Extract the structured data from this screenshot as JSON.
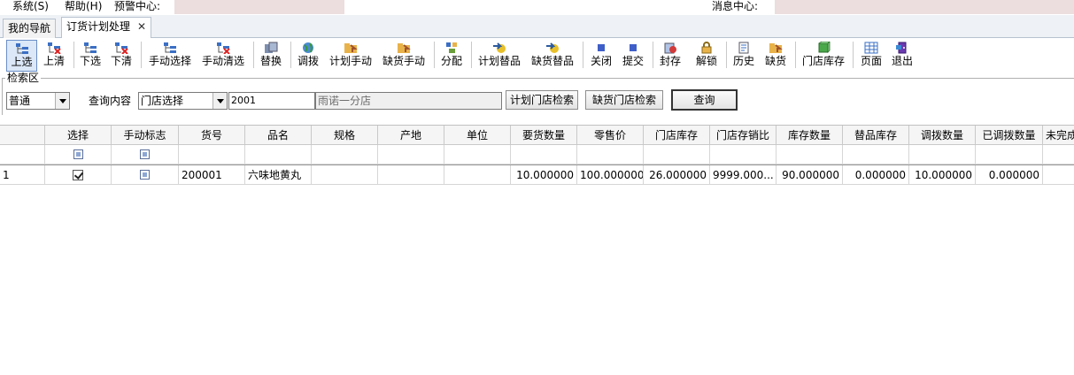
{
  "menubar": {
    "system": "系统(S)",
    "help": "帮助(H)",
    "alert_center": "预警中心:",
    "message_center": "消息中心:"
  },
  "tabs": [
    {
      "label": "我的导航"
    },
    {
      "label": "订货计划处理"
    }
  ],
  "toolbar": [
    {
      "label": "上选"
    },
    {
      "label": "上清"
    },
    {
      "label": "下选"
    },
    {
      "label": "下清"
    },
    {
      "label": "手动选择"
    },
    {
      "label": "手动清选"
    },
    {
      "label": "替换"
    },
    {
      "label": "调拨"
    },
    {
      "label": "计划手动"
    },
    {
      "label": "缺货手动"
    },
    {
      "label": "分配"
    },
    {
      "label": "计划替品"
    },
    {
      "label": "缺货替品"
    },
    {
      "label": "关闭"
    },
    {
      "label": "提交"
    },
    {
      "label": "封存"
    },
    {
      "label": "解锁"
    },
    {
      "label": "历史"
    },
    {
      "label": "缺货"
    },
    {
      "label": "门店库存"
    },
    {
      "label": "页面"
    },
    {
      "label": "退出"
    }
  ],
  "search": {
    "legend": "检索区",
    "mode_value": "普通",
    "query_label": "查询内容",
    "store_select_value": "门店选择",
    "store_code": "2001",
    "store_name": "雨诺一分店",
    "plan_store_search": "计划门店检索",
    "shortage_store_search": "缺货门店检索",
    "query_button": "查询"
  },
  "grid": {
    "headers": [
      "",
      "选择",
      "手动标志",
      "货号",
      "品名",
      "规格",
      "产地",
      "单位",
      "要货数量",
      "零售价",
      "门店库存",
      "门店存销比",
      "库存数量",
      "替品库存",
      "调拨数量",
      "已调拨数量",
      "未完成"
    ],
    "rows": [
      {
        "index": "1",
        "item_no": "200001",
        "name": "六味地黄丸",
        "spec": "",
        "origin": "",
        "unit": "",
        "order_qty": "10.000000",
        "retail_price": "100.000000",
        "store_stock": "26.000000",
        "stock_sales_ratio": "9999.000...",
        "stock_qty": "90.000000",
        "sub_stock": "0.000000",
        "transfer_qty": "10.000000",
        "transferred_qty": "0.000000",
        "unfinished": ""
      }
    ]
  }
}
